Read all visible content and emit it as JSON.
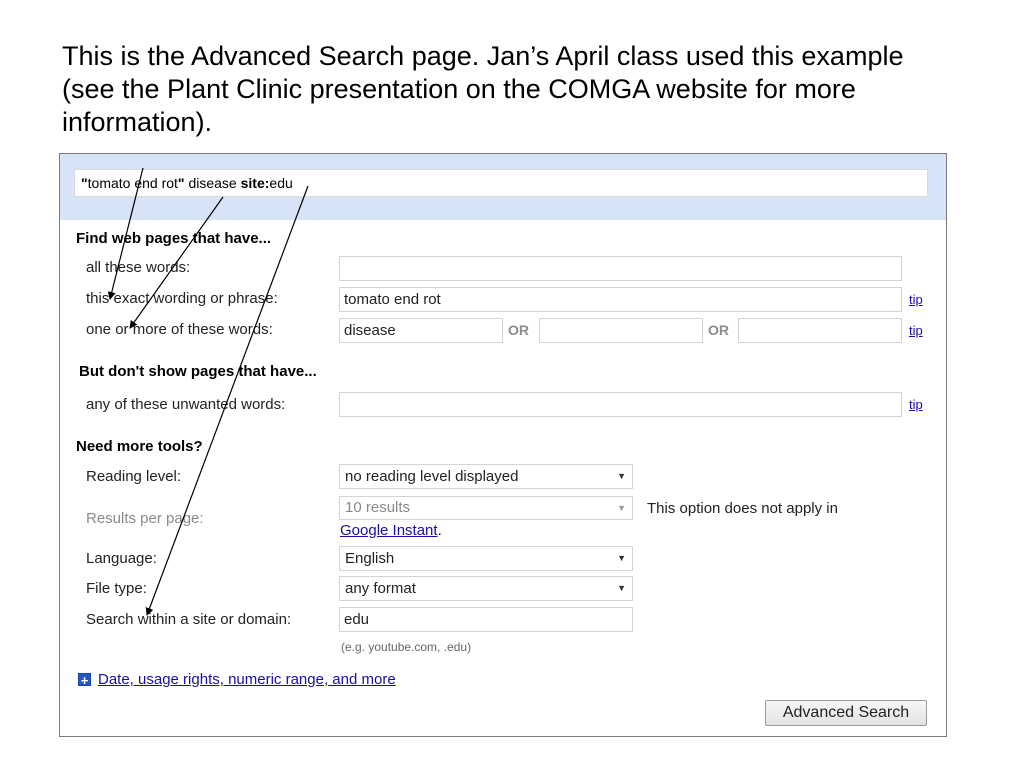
{
  "caption": {
    "line1": "This is the Advanced Search page. Jan’s April class used this example",
    "line2": "(see the Plant Clinic presentation on the COMGA website for more",
    "line3": "information)."
  },
  "query": {
    "q1": "\"",
    "q2": "tomato end rot",
    "q3": "\"",
    "q4": " disease ",
    "q5": "site:",
    "q6": "edu"
  },
  "find_section": {
    "heading": "Find web pages that have...",
    "all_words_label": "all these words:",
    "all_words_value": "",
    "exact_label": "this exact wording or phrase:",
    "exact_value": "tomato end rot",
    "any_label": "one or more of these words:",
    "any_value1": "disease",
    "any_value2": "",
    "any_value3": "",
    "or_label": "OR",
    "tip": "tip"
  },
  "exclude_section": {
    "heading": "But don't show pages that have...",
    "unwanted_label": "any of these unwanted words:",
    "unwanted_value": ""
  },
  "tools_section": {
    "heading": "Need more tools?",
    "reading_label": "Reading level:",
    "reading_value": "no reading level displayed",
    "results_label": "Results per page:",
    "results_value": "10 results",
    "results_note": "This option does not apply in",
    "instant_link": "Google Instant",
    "instant_period": ".",
    "language_label": "Language:",
    "language_value": "English",
    "filetype_label": "File type:",
    "filetype_value": "any format",
    "site_label": "Search within a site or domain:",
    "site_value": "edu",
    "site_hint": "(e.g. youtube.com, .edu)"
  },
  "more_link": "Date, usage rights, numeric range, and more",
  "submit_label": "Advanced Search",
  "colors": {
    "band": "#d7e3f6",
    "link": "#1a0dab",
    "plus": "#2458c8"
  }
}
